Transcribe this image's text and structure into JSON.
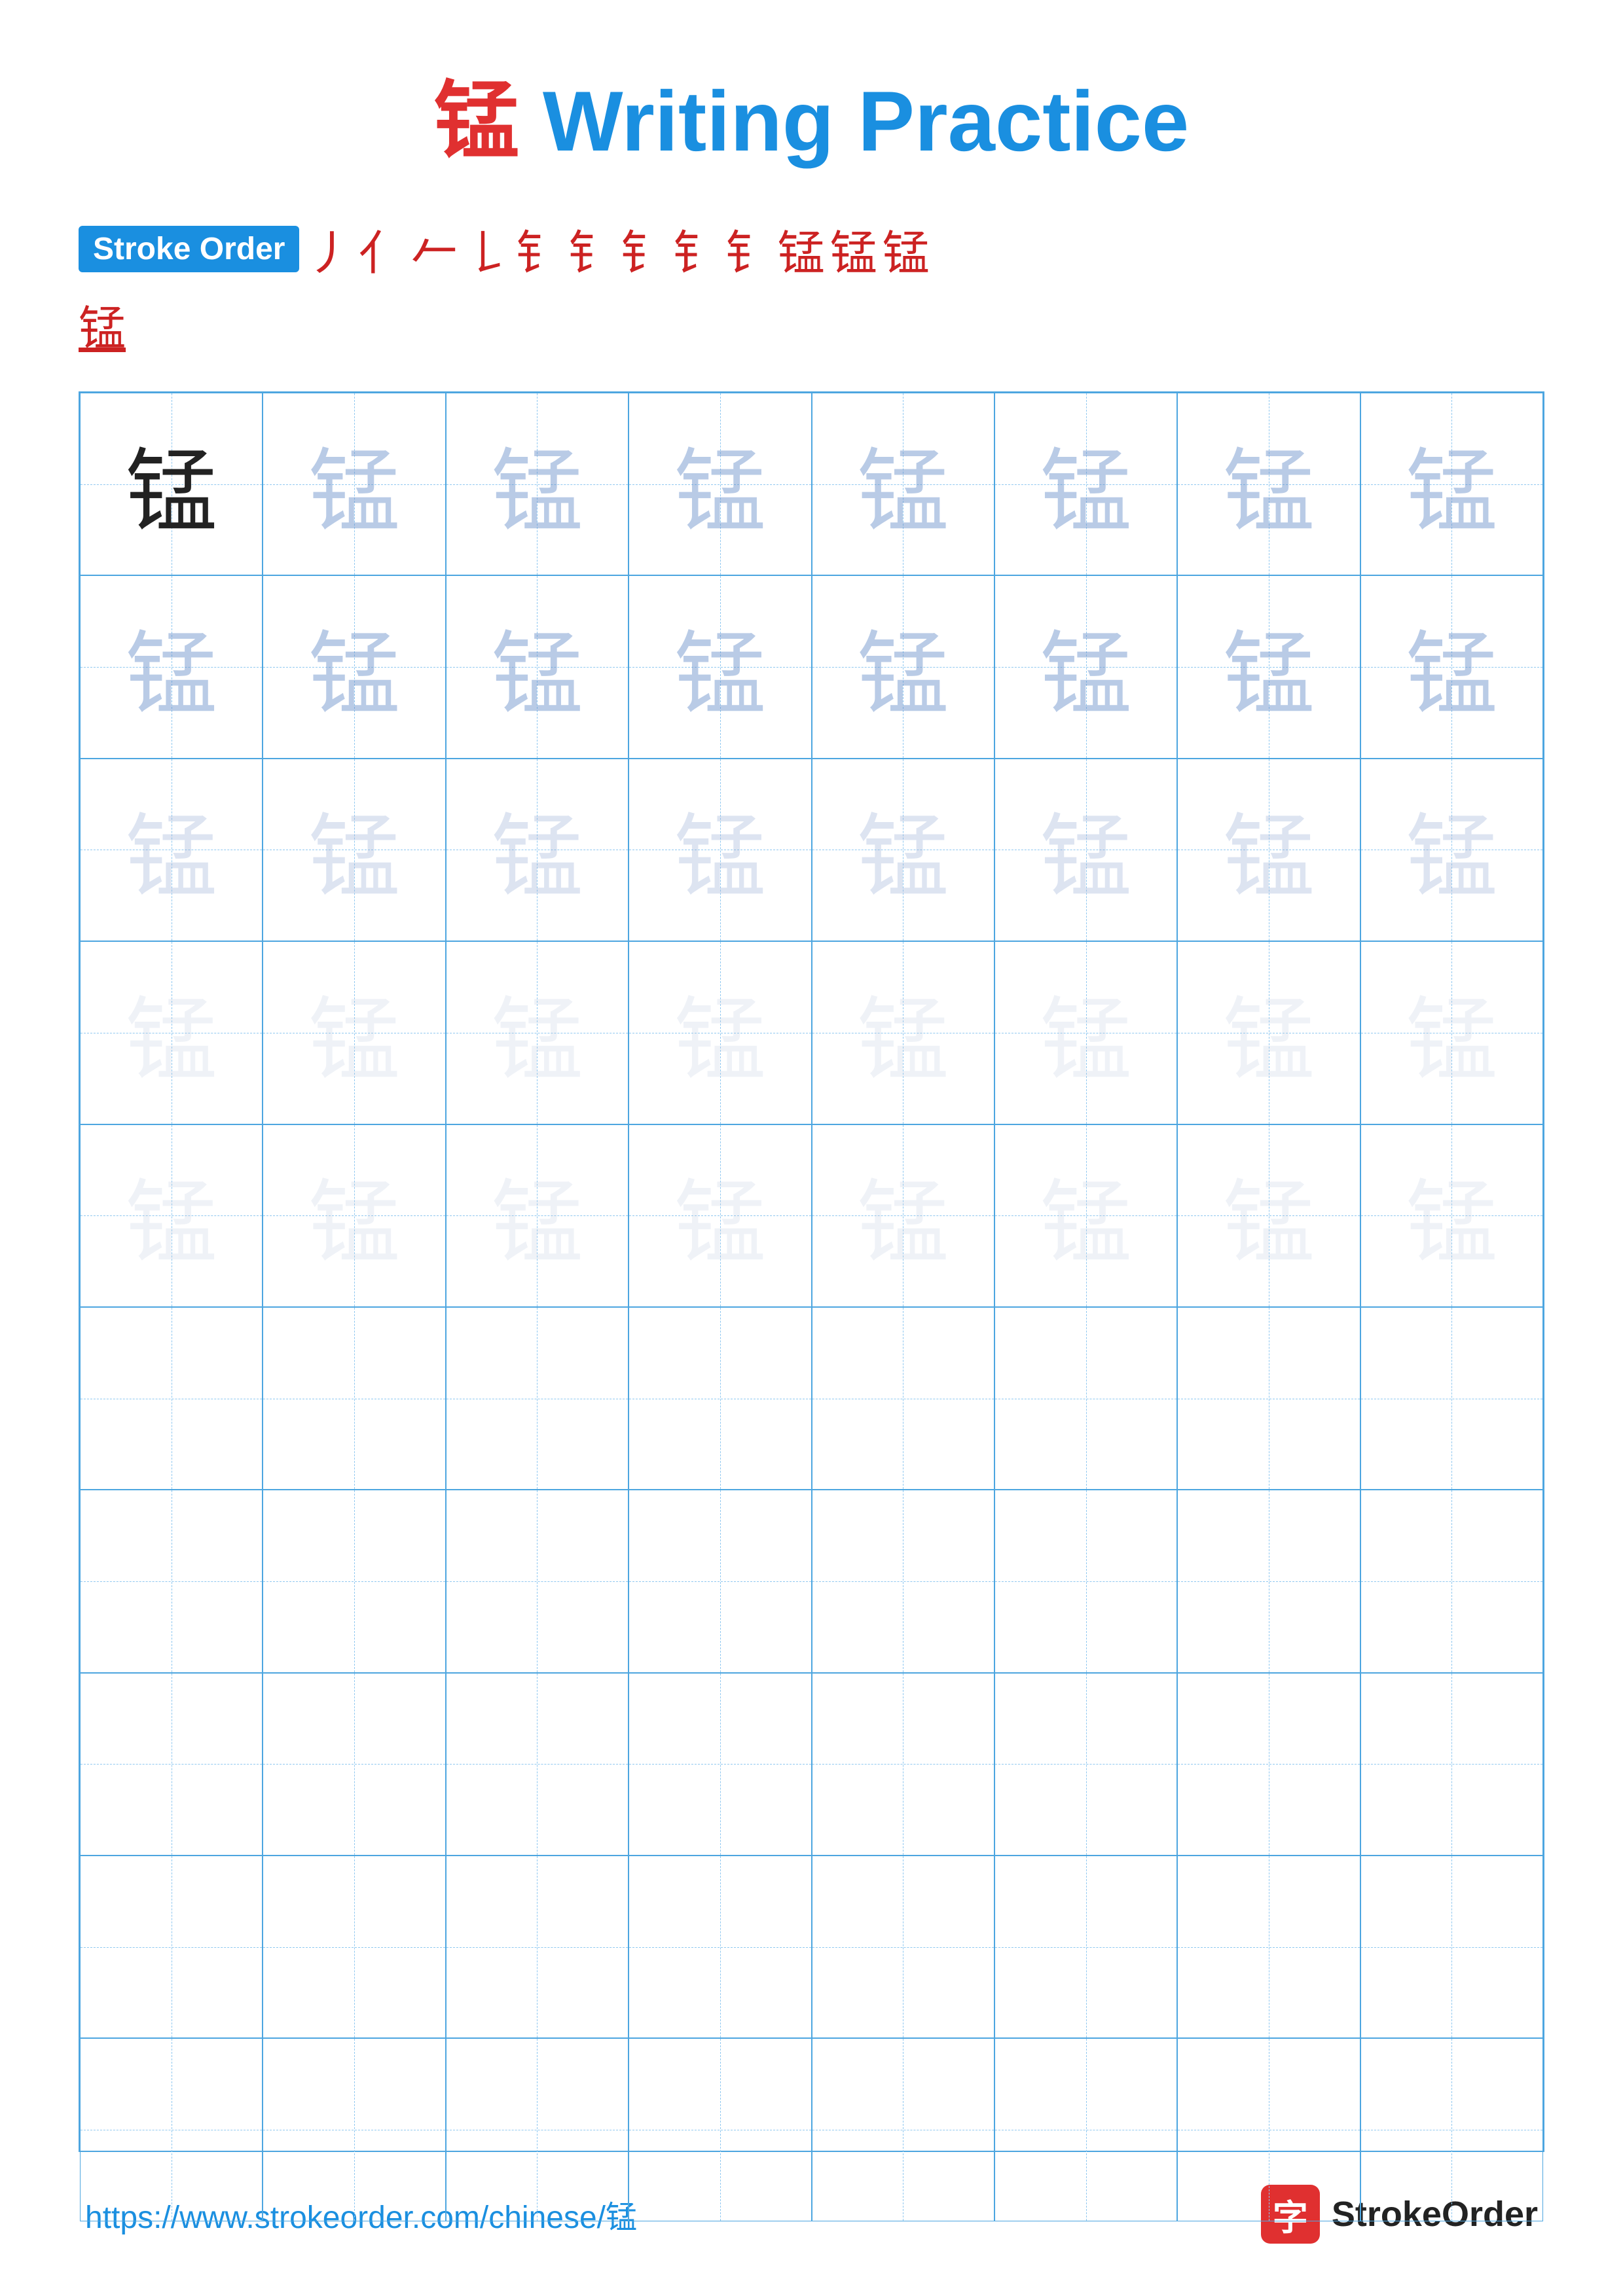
{
  "title": {
    "prefix_char": "锰",
    "text": " Writing Practice"
  },
  "stroke_order": {
    "label": "Stroke Order",
    "strokes": [
      "丿",
      "亻",
      "𠂉",
      "𠂉",
      "钅",
      "钅",
      "钅",
      "钅",
      "钅",
      "锰",
      "锰",
      "锰"
    ],
    "stroke_texts": [
      "/",
      "亻",
      "𠂉",
      "𠄌",
      "钅",
      "钅̈",
      "钅̃",
      "钅",
      "钅",
      "锰",
      "锰"
    ],
    "actual_strokes": [
      "丿",
      "ト",
      "𠂉",
      "𠄌",
      "钅",
      "钅",
      "钅",
      "钅",
      "钅",
      "锰",
      "锰",
      "锰"
    ]
  },
  "char": "锰",
  "grid": {
    "cols": 8,
    "rows": 10,
    "filled_rows": 5,
    "empty_rows": 5
  },
  "footer": {
    "url": "https://www.strokeorder.com/chinese/锰",
    "logo_char": "字",
    "logo_text": "StrokeOrder"
  },
  "opacity_levels": {
    "row1": "dark",
    "row2": "faint1",
    "row3": "faint2",
    "row4": "faint3",
    "row5": "faint3"
  }
}
